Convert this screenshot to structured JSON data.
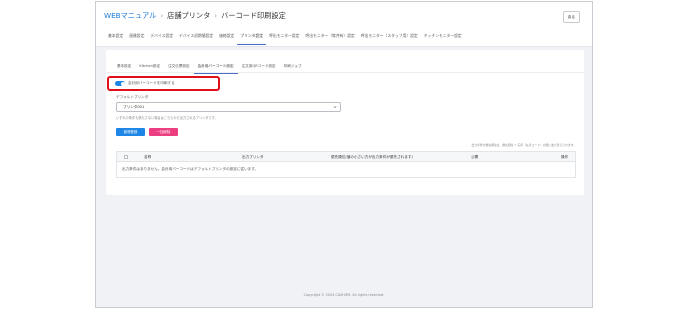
{
  "header": {
    "breadcrumb": [
      "WEBマニュアル",
      "店舗プリンタ",
      "バーコード印刷設定"
    ],
    "back_label": "戻る"
  },
  "main_tabs": [
    {
      "label": "基本設定"
    },
    {
      "label": "画像設定"
    },
    {
      "label": "デバイス設定"
    },
    {
      "label": "デバイス初期値設定"
    },
    {
      "label": "価格設定"
    },
    {
      "label": "プリンタ設定",
      "active": true
    },
    {
      "label": "呼出モニター設定"
    },
    {
      "label": "呼出モニター（席共有）設定"
    },
    {
      "label": "呼出モニター（スタッフ用）設定"
    },
    {
      "label": "キッチンモニター設定"
    }
  ],
  "sub_tabs": [
    {
      "label": "基本設定"
    },
    {
      "label": "Kitchen設定"
    },
    {
      "label": "注文伝票設定"
    },
    {
      "label": "会計用バーコード設定",
      "active": true
    },
    {
      "label": "注文用QRコード設定"
    },
    {
      "label": "印刷ジョブ"
    }
  ],
  "form": {
    "toggle_label": "会計用バーコードを印刷する",
    "toggle_on": true,
    "printer_label": "デフォルトプリンタ",
    "printer_value": "プリンタ001",
    "hint": "いずれの条件も満たさない場合はこちらから出力されるプリンタです。"
  },
  "buttons": {
    "new_label": "新規登録",
    "delete_label": "一括削除"
  },
  "table": {
    "note": "出力条件の優先順位は、優先順位 ↑ 矢印（左手コード）の順に並び替えられます。",
    "columns": [
      "名称",
      "出力プリンタ",
      "優先順位(値の小さい方が出力条件が優先されます)",
      "公開",
      "操作"
    ],
    "empty_message": "出力条件はありません。会計用バーコードはデフォルトプリンタの設定に従います。"
  },
  "footer": "Copyright © 2025 CASHIER. All rights reserved.",
  "colors": {
    "accent": "#1d86e6",
    "danger": "#ec3f82",
    "highlight": "#e0101a",
    "link": "#1a79d8"
  }
}
